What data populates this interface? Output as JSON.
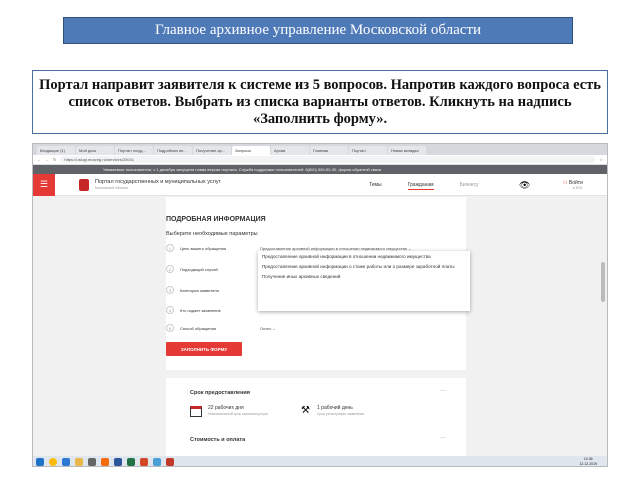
{
  "slide": {
    "title": "Главное архивное управление Московской области",
    "instruction": "Портал направит заявителя к системе из 5 вопросов. Напротив каждого вопроса есть список ответов. Выбрать из списка варианты ответов. Кликнуть на надпись «Заполнить форму»."
  },
  "browser": {
    "tabs": [
      "Входящие (1)",
      "Мой диск",
      "Портал госуд...",
      "Подробная ин...",
      "Получение ар...",
      "Запросы",
      "Архив",
      "Главная",
      "Портал",
      "Новая вкладка"
    ],
    "url": "https://uslugi.mosreg.ru/services/20041"
  },
  "site": {
    "notice": "Уважаемые пользователи, с 1 декабря запущена новая версия портала. Служба поддержки пользователей: 8(800) 550-50-30, форма обратной связи",
    "portal_name": "Портал государственных и муниципальных услуг",
    "portal_sub": "Московской области",
    "nav": [
      "Темы",
      "Гражданам",
      "Бизнесу"
    ],
    "login": "Войти",
    "login_sub": "в ЕЛК"
  },
  "form": {
    "heading": "ПОДРОБНАЯ ИНФОРМАЦИЯ",
    "subheading": "Выберите необходимые параметры",
    "params": [
      {
        "num": "1",
        "label": "Цель вашего обращения",
        "value": "Предоставление архивной информации в отношении недвижимого имущества ⌄"
      },
      {
        "num": "2",
        "label": "Подходящий случай",
        "value": ""
      },
      {
        "num": "3",
        "label": "Категория заявителя",
        "value": ""
      },
      {
        "num": "4",
        "label": "Кто подает заявление",
        "value": ""
      },
      {
        "num": "5",
        "label": "Способ обращения",
        "value": "Лично ⌄"
      }
    ],
    "dropdown_options": [
      "Предоставление архивной информации в отношении недвижимого имущества",
      "Предоставление архивной информации о стаже работы или о размере заработной платы",
      "Получение иных архивных сведений"
    ],
    "fill_button": "ЗАПОЛНИТЬ ФОРМУ"
  },
  "info": {
    "term_title": "Срок предоставления",
    "days_label": "22 рабочих дня",
    "days_sub": "Максимальный срок оказания услуги",
    "day_label": "1 рабочий день",
    "day_sub": "Срок регистрации заявления",
    "cost_title": "Стоимость и оплата",
    "more": "···"
  },
  "taskbar": {
    "time": "10:36",
    "date": "12.12.2019"
  }
}
